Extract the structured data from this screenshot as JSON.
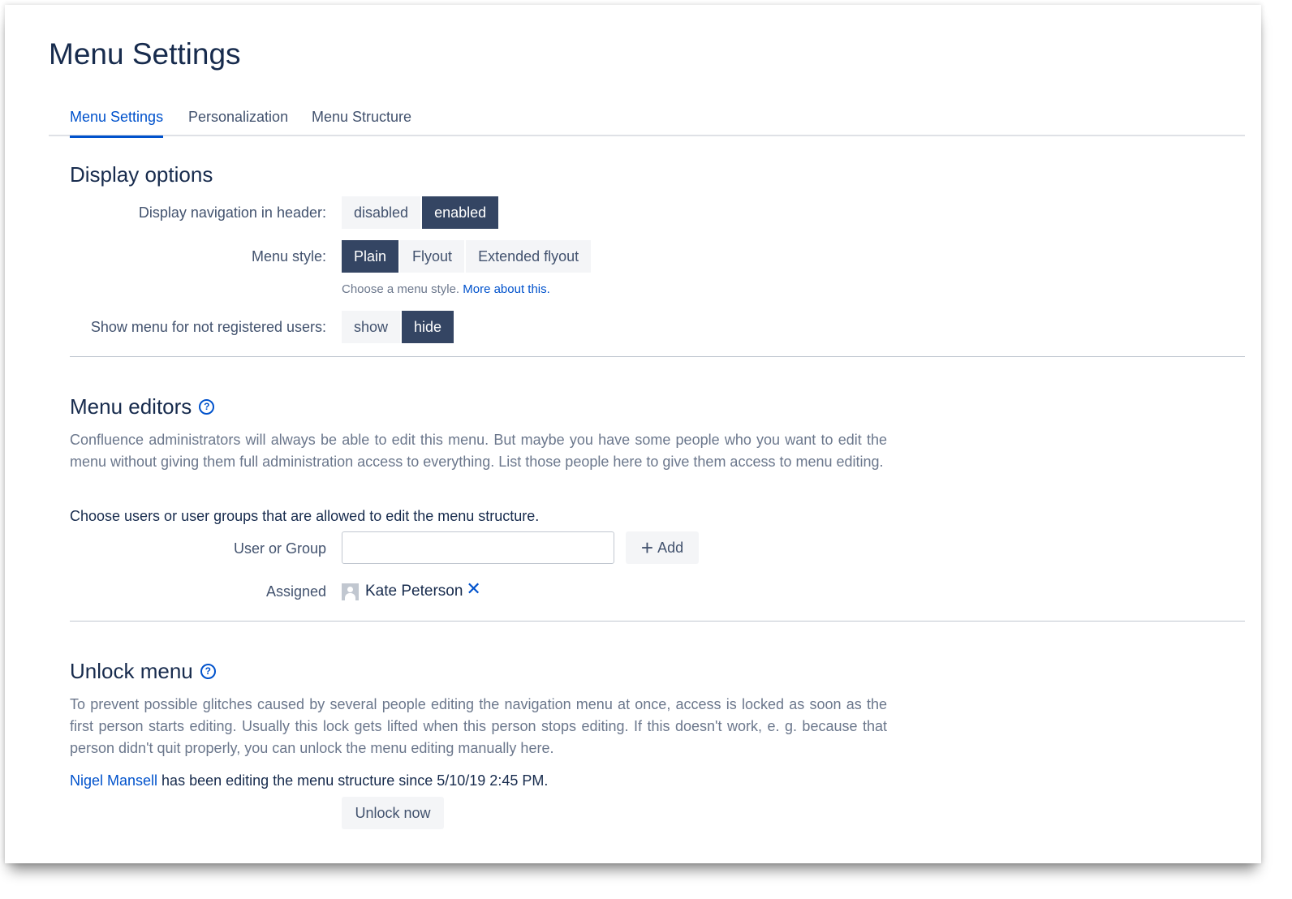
{
  "page": {
    "title": "Menu Settings"
  },
  "tabs": [
    {
      "label": "Menu Settings",
      "active": true
    },
    {
      "label": "Personalization",
      "active": false
    },
    {
      "label": "Menu Structure",
      "active": false
    }
  ],
  "display_options": {
    "title": "Display options",
    "navigation_header": {
      "label": "Display navigation in header:",
      "options": [
        "disabled",
        "enabled"
      ],
      "selected": "enabled"
    },
    "menu_style": {
      "label": "Menu style:",
      "options": [
        "Plain",
        "Flyout",
        "Extended flyout"
      ],
      "selected": "Plain"
    },
    "menu_style_hint": {
      "text": "Choose a menu style.",
      "link": "More about this."
    },
    "show_menu": {
      "label": "Show menu for not registered users:",
      "options": [
        "show",
        "hide"
      ],
      "selected": "hide"
    }
  },
  "menu_editors": {
    "title": "Menu editors",
    "help_icon": "?",
    "description": "Confluence administrators will always be able to edit this menu. But maybe you have some people who you want to edit the menu without giving them full administration access to everything. List those people here to give them access to menu editing.",
    "instruction": "Choose users or user groups that are allowed to edit the menu structure.",
    "user_group_label": "User or Group",
    "user_group_value": "",
    "add_icon": "+",
    "add_label": "Add",
    "assigned_label": "Assigned",
    "assigned_users": [
      "Kate Peterson"
    ],
    "remove_icon": "✕"
  },
  "unlock_menu": {
    "title": "Unlock menu",
    "help_icon": "?",
    "description": "To prevent possible glitches caused by several people editing the navigation menu at once, access is locked as soon as the first person starts editing. Usually this lock gets lifted when this person stops editing. If this doesn't work, e. g. because that person didn't quit properly, you can unlock the menu editing manually here.",
    "editor_name": "Nigel Mansell",
    "status_text": " has been editing the menu structure since 5/10/19 2:45 PM.",
    "button_label": "Unlock now"
  },
  "colors": {
    "accent": "#0052cc",
    "selected_button": "#344563",
    "button_bg": "#f4f5f7",
    "heading": "#172b4d",
    "muted_text": "#6b778c"
  }
}
